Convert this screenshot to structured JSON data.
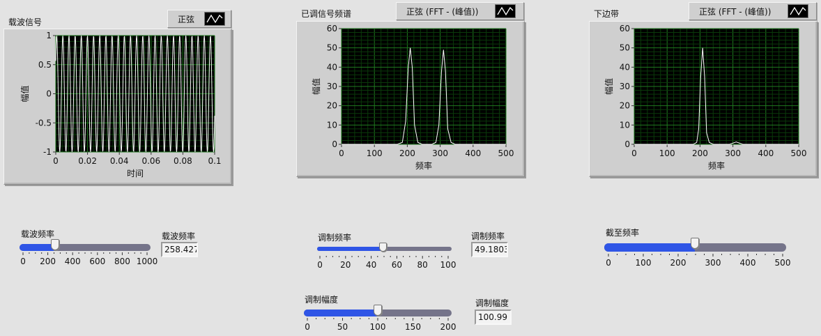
{
  "carrier_graph": {
    "title": "载波信号",
    "legend_label": "正弦",
    "xlabel": "时间",
    "ylabel": "幅值",
    "x_ticks": [
      "0",
      "0.02",
      "0.04",
      "0.06",
      "0.08",
      "0.1"
    ],
    "y_ticks": [
      "1",
      "0.5",
      "0",
      "-0.5",
      "-1"
    ]
  },
  "modulated_graph": {
    "title": "已调信号频谱",
    "legend_label": "正弦 (FFT - (峰值))",
    "xlabel": "频率",
    "ylabel": "幅值",
    "x_ticks": [
      "0",
      "100",
      "200",
      "300",
      "400",
      "500"
    ],
    "y_ticks": [
      "60",
      "50",
      "40",
      "30",
      "20",
      "10",
      "0"
    ]
  },
  "lower_graph": {
    "title": "下边带",
    "legend_label": "正弦 (FFT - (峰值))",
    "xlabel": "频率",
    "ylabel": "幅值",
    "x_ticks": [
      "0",
      "100",
      "200",
      "300",
      "400",
      "500"
    ],
    "y_ticks": [
      "60",
      "50",
      "40",
      "30",
      "20",
      "10",
      "0"
    ]
  },
  "controls": {
    "carrier_freq": {
      "label": "载波频率",
      "indicator_label": "载波频率",
      "value_text": "258.427",
      "value": 258.427,
      "min": 0,
      "max": 1000,
      "ticks": [
        "0",
        "200",
        "400",
        "600",
        "800",
        "1000"
      ]
    },
    "mod_freq": {
      "label": "调制频率",
      "indicator_label": "调制频率",
      "value_text": "49.1803",
      "value": 49.1803,
      "min": 0,
      "max": 100,
      "ticks": [
        "0",
        "20",
        "40",
        "60",
        "80",
        "100"
      ]
    },
    "mod_amp": {
      "label": "调制幅度",
      "indicator_label": "调制幅度",
      "value_text": "100.99",
      "value": 100.99,
      "min": 0,
      "max": 200,
      "ticks": [
        "0",
        "50",
        "100",
        "150",
        "200"
      ]
    },
    "cutoff_freq": {
      "label": "截至频率",
      "value": 250,
      "min": 0,
      "max": 500,
      "ticks": [
        "0",
        "100",
        "200",
        "300",
        "400",
        "500"
      ]
    }
  },
  "colors": {
    "plot_background": "#000000",
    "trace": "#ffffff",
    "grid_major": "#1f7a1f",
    "slider_fill": "#2f55e6",
    "slider_track": "#75748a"
  },
  "chart_data": [
    {
      "type": "line",
      "name": "carrier",
      "title": "载波信号",
      "xlabel": "时间",
      "ylabel": "幅值",
      "xlim": [
        0,
        0.1
      ],
      "ylim": [
        -1,
        1
      ],
      "grid": true,
      "description_values": {
        "amplitude": 1,
        "frequency": 258.427
      }
    },
    {
      "type": "line",
      "name": "modulated-spectrum",
      "title": "已调信号频谱",
      "xlabel": "频率",
      "ylabel": "幅值",
      "xlim": [
        0,
        500
      ],
      "ylim": [
        0,
        60
      ],
      "grid": true,
      "x": [
        0,
        170,
        185,
        195,
        203,
        209,
        215,
        222,
        232,
        245,
        275,
        287,
        296,
        304,
        310,
        316,
        323,
        333,
        345,
        400,
        500
      ],
      "y": [
        0,
        0,
        1,
        12,
        40,
        50,
        40,
        10,
        1,
        0,
        0,
        1,
        10,
        38,
        49,
        38,
        8,
        1,
        0,
        0,
        0
      ]
    },
    {
      "type": "line",
      "name": "lower-sideband",
      "title": "下边带",
      "xlabel": "频率",
      "ylabel": "幅值",
      "xlim": [
        0,
        500
      ],
      "ylim": [
        0,
        60
      ],
      "grid": true,
      "x": [
        0,
        180,
        190,
        196,
        202,
        208,
        214,
        220,
        228,
        240,
        290,
        300,
        310,
        320,
        330,
        400,
        500
      ],
      "y": [
        0,
        0,
        1,
        8,
        35,
        50,
        35,
        6,
        1,
        0,
        0,
        0.6,
        1.2,
        0.6,
        0,
        0,
        0
      ]
    }
  ]
}
